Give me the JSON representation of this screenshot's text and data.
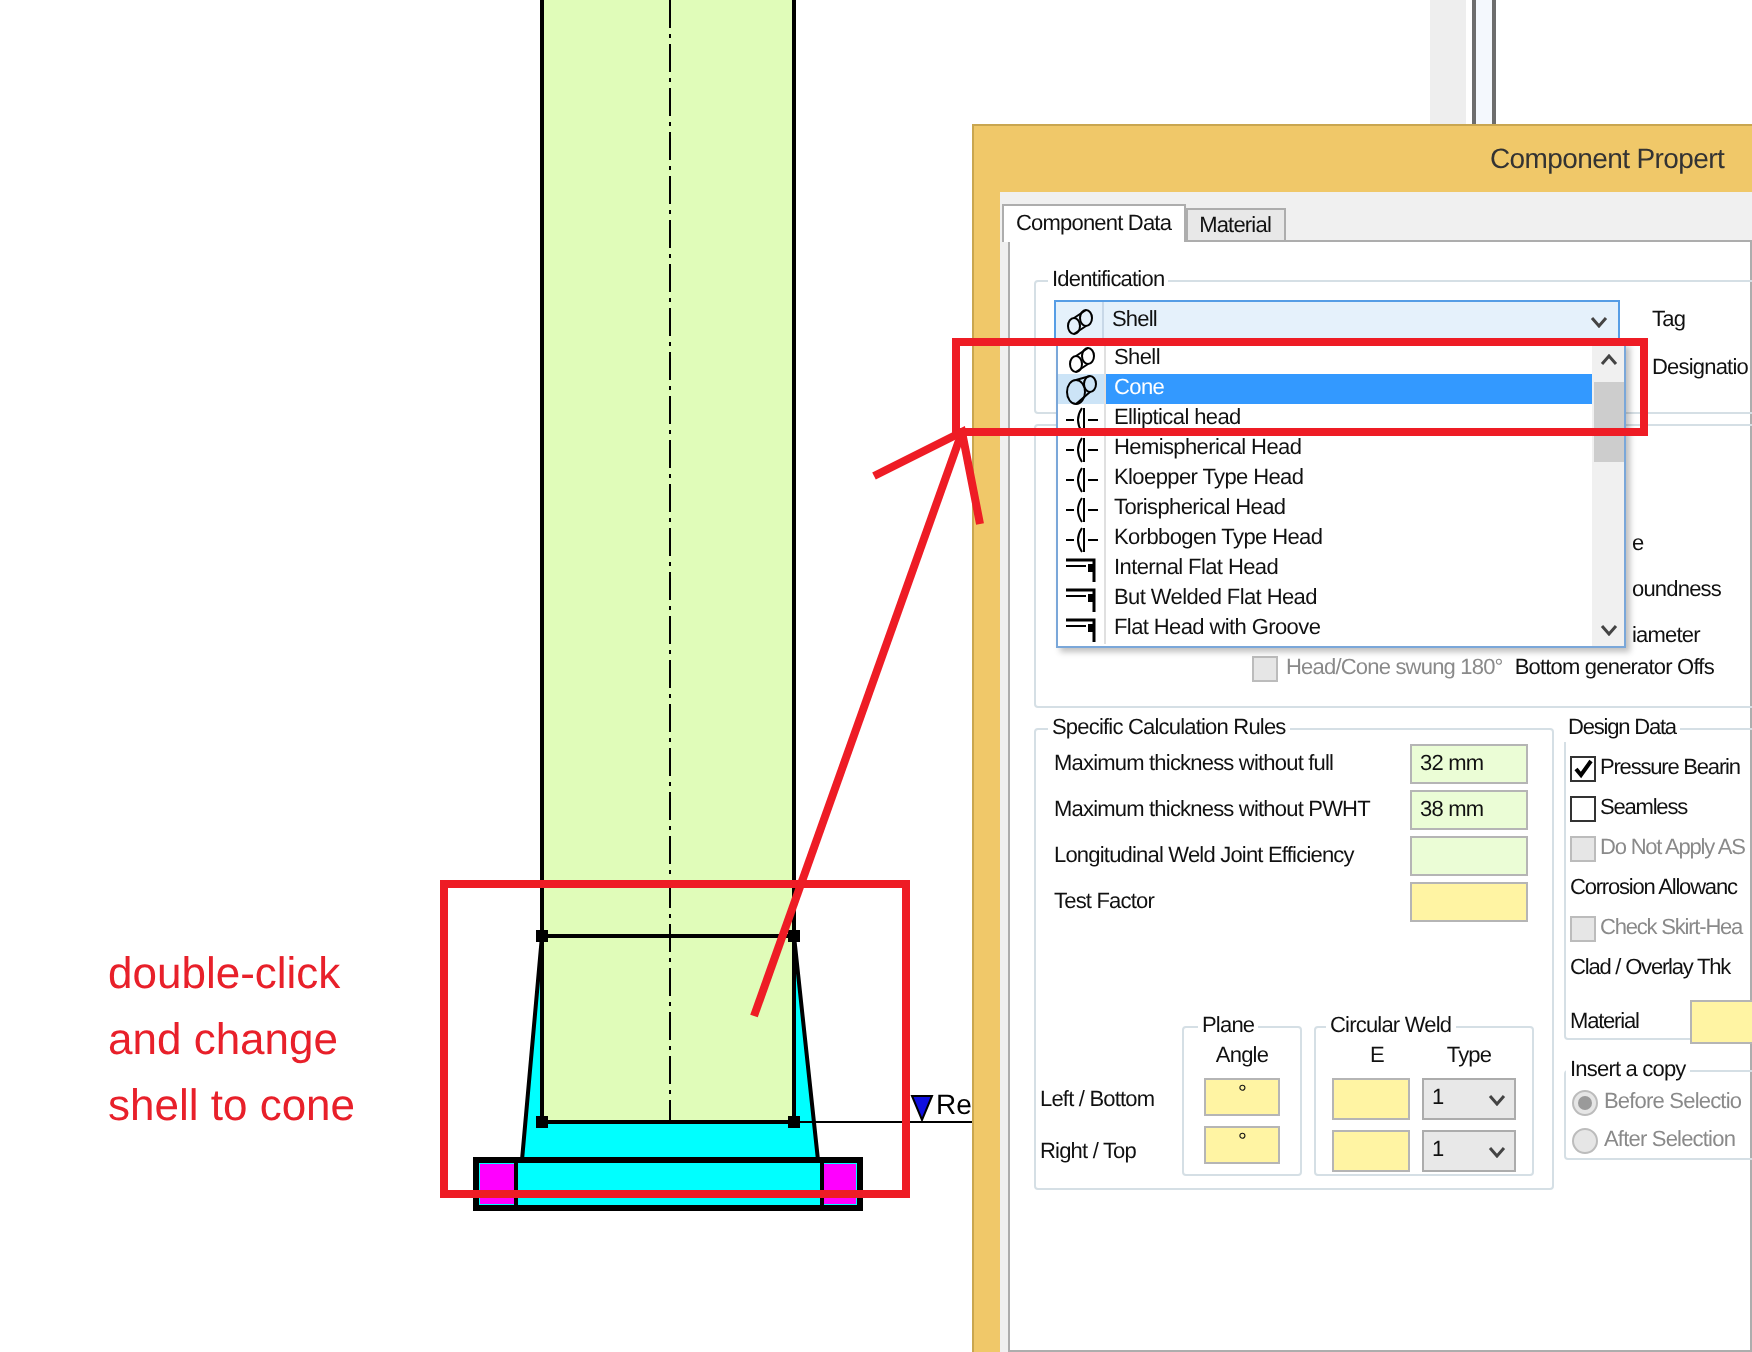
{
  "canvas": {
    "reference_label": "Re"
  },
  "annotation": {
    "text": "double-click and change shell to cone"
  },
  "dialog": {
    "title": "Component Propert",
    "tabs": [
      {
        "label": "Component Data",
        "selected": true
      },
      {
        "label": "Material",
        "selected": false
      }
    ],
    "identification": {
      "title": "Identification",
      "type_combo": {
        "value": "Shell",
        "kind": "shell"
      },
      "labels": [
        "Tag",
        "Designatio"
      ]
    },
    "type_dropdown": {
      "items": [
        {
          "label": "Shell",
          "kind": "shell",
          "selected": false
        },
        {
          "label": "Cone",
          "kind": "cone",
          "selected": true
        },
        {
          "label": "Elliptical head",
          "kind": "head",
          "selected": false
        },
        {
          "label": "Hemispherical Head",
          "kind": "head",
          "selected": false
        },
        {
          "label": "Kloepper Type Head",
          "kind": "head",
          "selected": false
        },
        {
          "label": "Torispherical Head",
          "kind": "head",
          "selected": false
        },
        {
          "label": "Korbbogen Type Head",
          "kind": "head",
          "selected": false
        },
        {
          "label": "Internal Flat Head",
          "kind": "flat_head",
          "selected": false
        },
        {
          "label": "But Welded Flat Head",
          "kind": "flat_head",
          "selected": false
        },
        {
          "label": "Flat Head with Groove",
          "kind": "flat_head",
          "selected": false
        }
      ]
    },
    "geometry": {
      "labels": [
        "e",
        "oundness",
        "iameter"
      ],
      "swung_checkbox": {
        "label": "Head/Cone swung 180°",
        "checked": false,
        "disabled": true
      },
      "offset_label": "Bottom generator Offs"
    },
    "calculation_rules": {
      "title": "Specific Calculation Rules",
      "rows": [
        {
          "label": "Maximum thickness without full",
          "value": "32 mm",
          "kind": "computed"
        },
        {
          "label": "Maximum thickness without PWHT",
          "value": "38 mm",
          "kind": "computed"
        },
        {
          "label": "Longitudinal Weld Joint Efficiency",
          "kind": "computed"
        },
        {
          "label": "Test Factor",
          "kind": "input"
        }
      ]
    },
    "weld": {
      "plane_title": "Plane",
      "angle_header": "Angle",
      "circular_title": "Circular Weld",
      "e_header": "E",
      "type_header": "Type",
      "rows": [
        {
          "label": "Left / Bottom",
          "angle": "°",
          "type": "1"
        },
        {
          "label": "Right / Top",
          "angle": "°",
          "type": "1"
        }
      ]
    },
    "design_data": {
      "title": "Design Data",
      "items": [
        {
          "kind": "checkbox",
          "label": "Pressure Bearin",
          "checked": true,
          "disabled": false
        },
        {
          "kind": "checkbox",
          "label": "Seamless",
          "checked": false,
          "disabled": false
        },
        {
          "kind": "checkbox",
          "label": "Do Not Apply AS",
          "checked": false,
          "disabled": true
        },
        {
          "kind": "label",
          "label": "Corrosion Allowanc"
        },
        {
          "kind": "checkbox",
          "label": "Check Skirt-Hea",
          "checked": false,
          "disabled": true
        },
        {
          "kind": "label",
          "label": "Clad / Overlay Thk"
        },
        {
          "kind": "field",
          "label": "Material"
        }
      ]
    },
    "insert_copy": {
      "title": "Insert a copy",
      "options": [
        {
          "label": "Before Selectio",
          "selected": true,
          "disabled": true
        },
        {
          "label": "After Selection",
          "selected": false,
          "disabled": true
        }
      ]
    }
  }
}
